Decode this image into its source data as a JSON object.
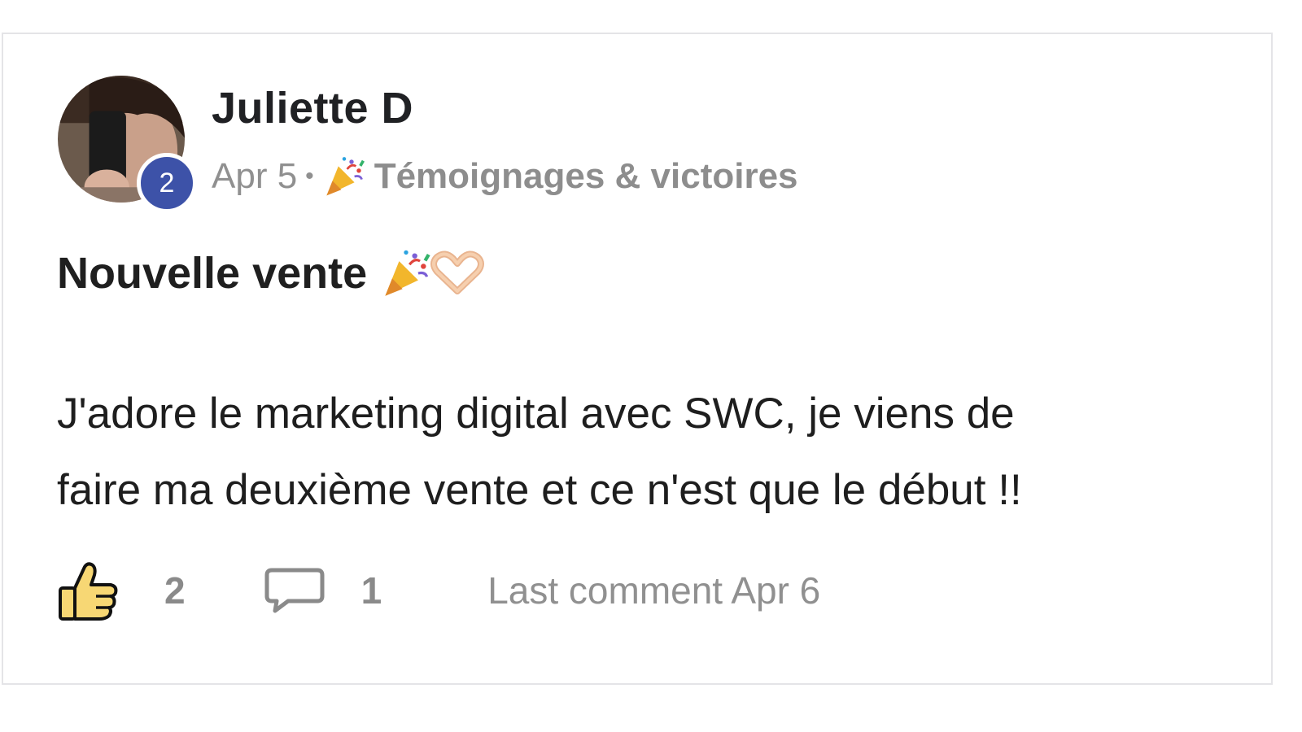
{
  "post": {
    "author": {
      "name": "Juliette D",
      "level": "2"
    },
    "date": "Apr 5",
    "separator": "•",
    "category": {
      "icon": "party-popper-icon",
      "name": "Témoignages & victoires"
    },
    "title": "Nouvelle vente",
    "title_icons": [
      "party-popper-icon",
      "heart-hands-icon"
    ],
    "body_lines": [
      "J'adore le marketing digital avec SWC, je viens de",
      "faire ma deuxième vente et ce n'est que le début !!"
    ],
    "footer": {
      "like_icon": "thumbs-up-icon",
      "likes": "2",
      "comment_icon": "comment-bubble-icon",
      "comments": "1",
      "last_comment": "Last comment Apr 6"
    }
  },
  "colors": {
    "badge": "#3d52a8",
    "muted_text": "#909090",
    "like_fill": "#f7d774",
    "border": "#e4e4e7"
  }
}
